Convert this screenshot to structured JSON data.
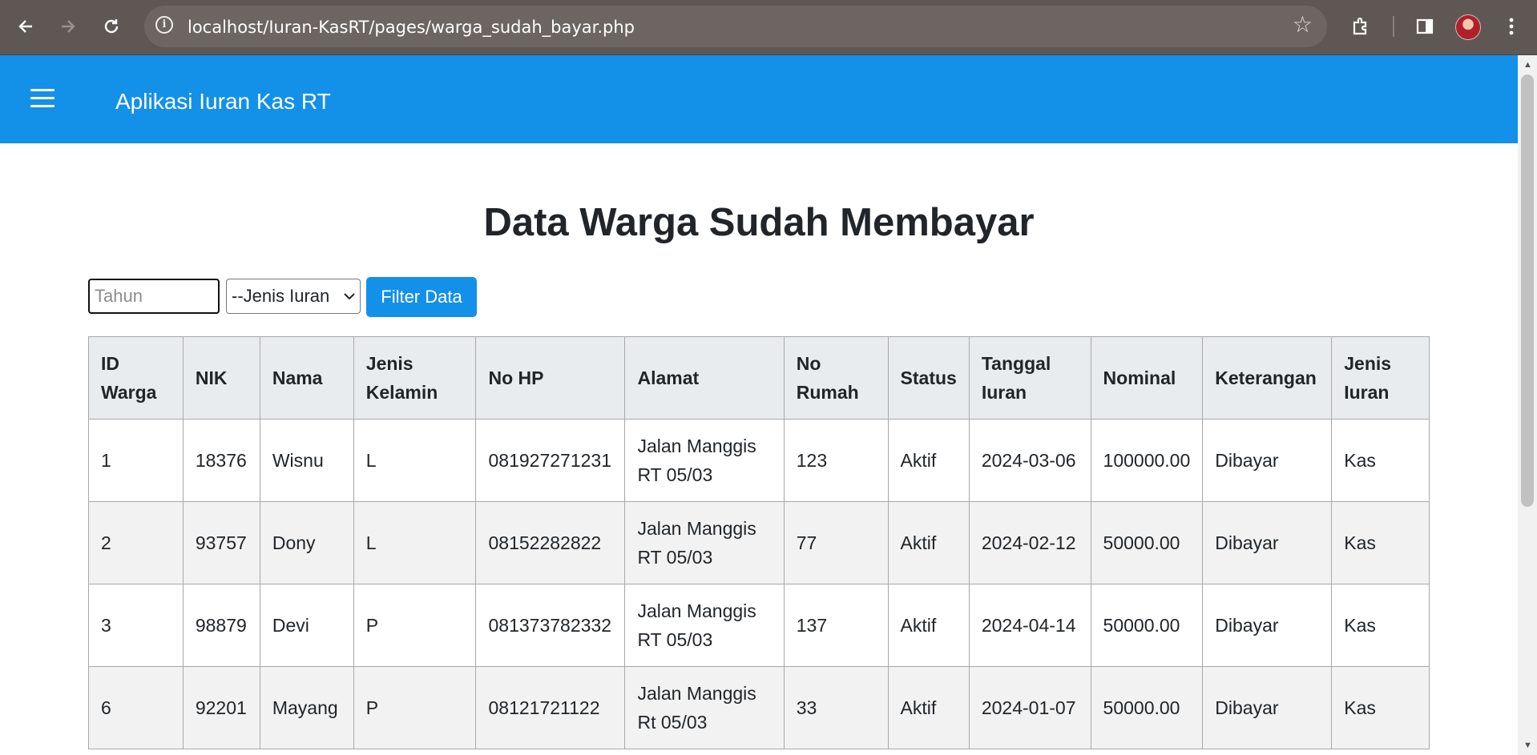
{
  "browser": {
    "url": "localhost/Iuran-KasRT/pages/warga_sudah_bayar.php",
    "icons": [
      "back-icon",
      "forward-icon",
      "reload-icon",
      "site-info-icon",
      "bookmark-star-icon",
      "extensions-icon",
      "side-panel-icon",
      "profile-avatar",
      "menu-icon"
    ]
  },
  "app": {
    "title": "Aplikasi Iuran Kas RT",
    "header_color": "#1390e8"
  },
  "page": {
    "title": "Data Warga Sudah Membayar"
  },
  "filter": {
    "year_placeholder": "Tahun",
    "year_value": "",
    "type_selected": "--Jenis Iuran",
    "button_label": "Filter Data"
  },
  "table": {
    "headers": [
      "ID Warga",
      "NIK",
      "Nama",
      "Jenis Kelamin",
      "No HP",
      "Alamat",
      "No Rumah",
      "Status",
      "Tanggal Iuran",
      "Nominal",
      "Keterangan",
      "Jenis Iuran"
    ],
    "rows": [
      [
        "1",
        "18376",
        "Wisnu",
        "L",
        "081927271231",
        "Jalan Manggis RT 05/03",
        "123",
        "Aktif",
        "2024-03-06",
        "100000.00",
        "Dibayar",
        "Kas"
      ],
      [
        "2",
        "93757",
        "Dony",
        "L",
        "08152282822",
        "Jalan Manggis RT 05/03",
        "77",
        "Aktif",
        "2024-02-12",
        "50000.00",
        "Dibayar",
        "Kas"
      ],
      [
        "3",
        "98879",
        "Devi",
        "P",
        "081373782332",
        "Jalan Manggis RT 05/03",
        "137",
        "Aktif",
        "2024-04-14",
        "50000.00",
        "Dibayar",
        "Kas"
      ],
      [
        "6",
        "92201",
        "Mayang",
        "P",
        "08121721122",
        "Jalan Manggis Rt 05/03",
        "33",
        "Aktif",
        "2024-01-07",
        "50000.00",
        "Dibayar",
        "Kas"
      ]
    ]
  }
}
